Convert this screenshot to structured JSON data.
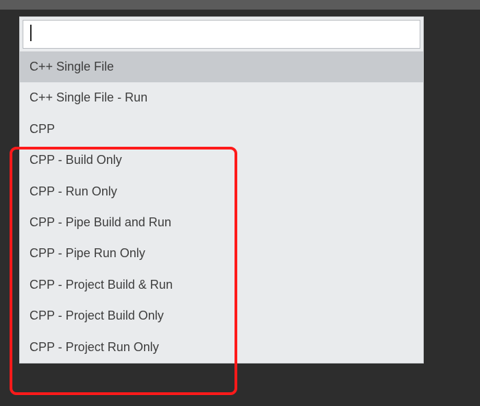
{
  "search": {
    "value": "",
    "placeholder": ""
  },
  "items": [
    {
      "label": "C++ Single File",
      "selected": true
    },
    {
      "label": "C++ Single File - Run",
      "selected": false
    },
    {
      "label": "CPP",
      "selected": false
    },
    {
      "label": "CPP - Build Only",
      "selected": false
    },
    {
      "label": "CPP - Run Only",
      "selected": false
    },
    {
      "label": "CPP - Pipe Build and Run",
      "selected": false
    },
    {
      "label": "CPP - Pipe Run Only",
      "selected": false
    },
    {
      "label": "CPP - Project Build & Run",
      "selected": false
    },
    {
      "label": "CPP - Project Build Only",
      "selected": false
    },
    {
      "label": "CPP - Project Run Only",
      "selected": false
    }
  ],
  "annotation": {
    "highlight_color": "#ff1a1a"
  }
}
